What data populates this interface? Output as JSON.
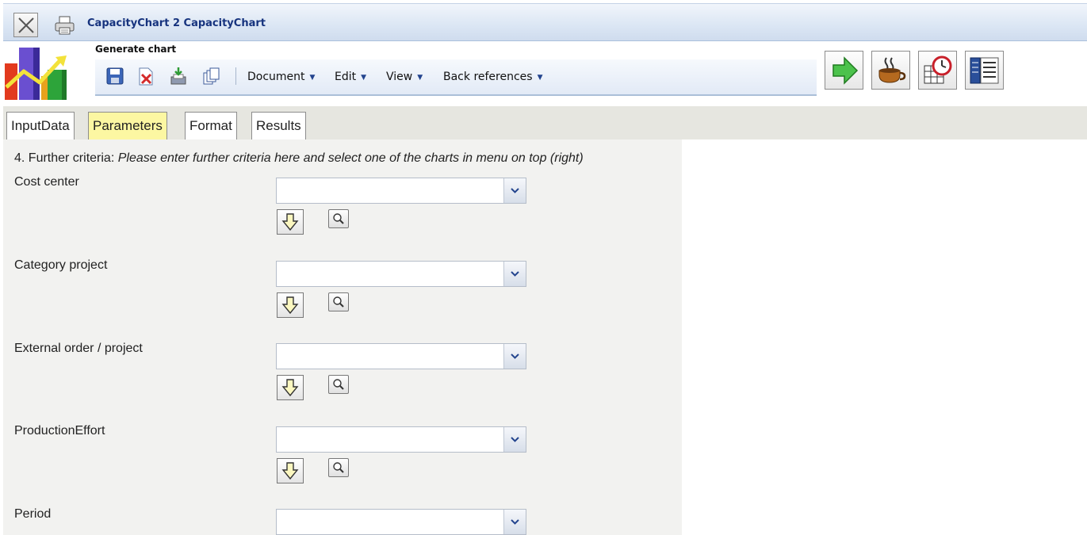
{
  "window": {
    "title": "CapacityChart 2 CapacityChart"
  },
  "header": {
    "subtitle": "Generate chart"
  },
  "toolbar": {
    "icons": [
      "save-icon",
      "delete-icon",
      "export-icon",
      "copy-icon"
    ],
    "menus": [
      "Document",
      "Edit",
      "View",
      "Back references"
    ],
    "right_buttons": [
      "next-arrow-icon",
      "coffee-icon",
      "clock-calendar-icon",
      "report-list-icon"
    ]
  },
  "tabs": [
    {
      "label": "InputData",
      "active": false
    },
    {
      "label": "Parameters",
      "active": true
    },
    {
      "label": "Format",
      "active": false
    },
    {
      "label": "Results",
      "active": false
    }
  ],
  "form": {
    "criteria_prefix": "4. Further criteria:",
    "criteria_hint": "Please enter further criteria here and select one of the charts in menu on top (right)",
    "fields": [
      {
        "label": "Cost center",
        "value": ""
      },
      {
        "label": "Category project",
        "value": ""
      },
      {
        "label": "External order / project",
        "value": ""
      },
      {
        "label": "ProductionEffort",
        "value": ""
      },
      {
        "label": "Period",
        "value": ""
      }
    ]
  },
  "colors": {
    "title_text": "#16337e",
    "active_tab": "#fcf7a2",
    "panel_bg": "#f2f2f0",
    "tabstrip_bg": "#e6e6e0"
  }
}
